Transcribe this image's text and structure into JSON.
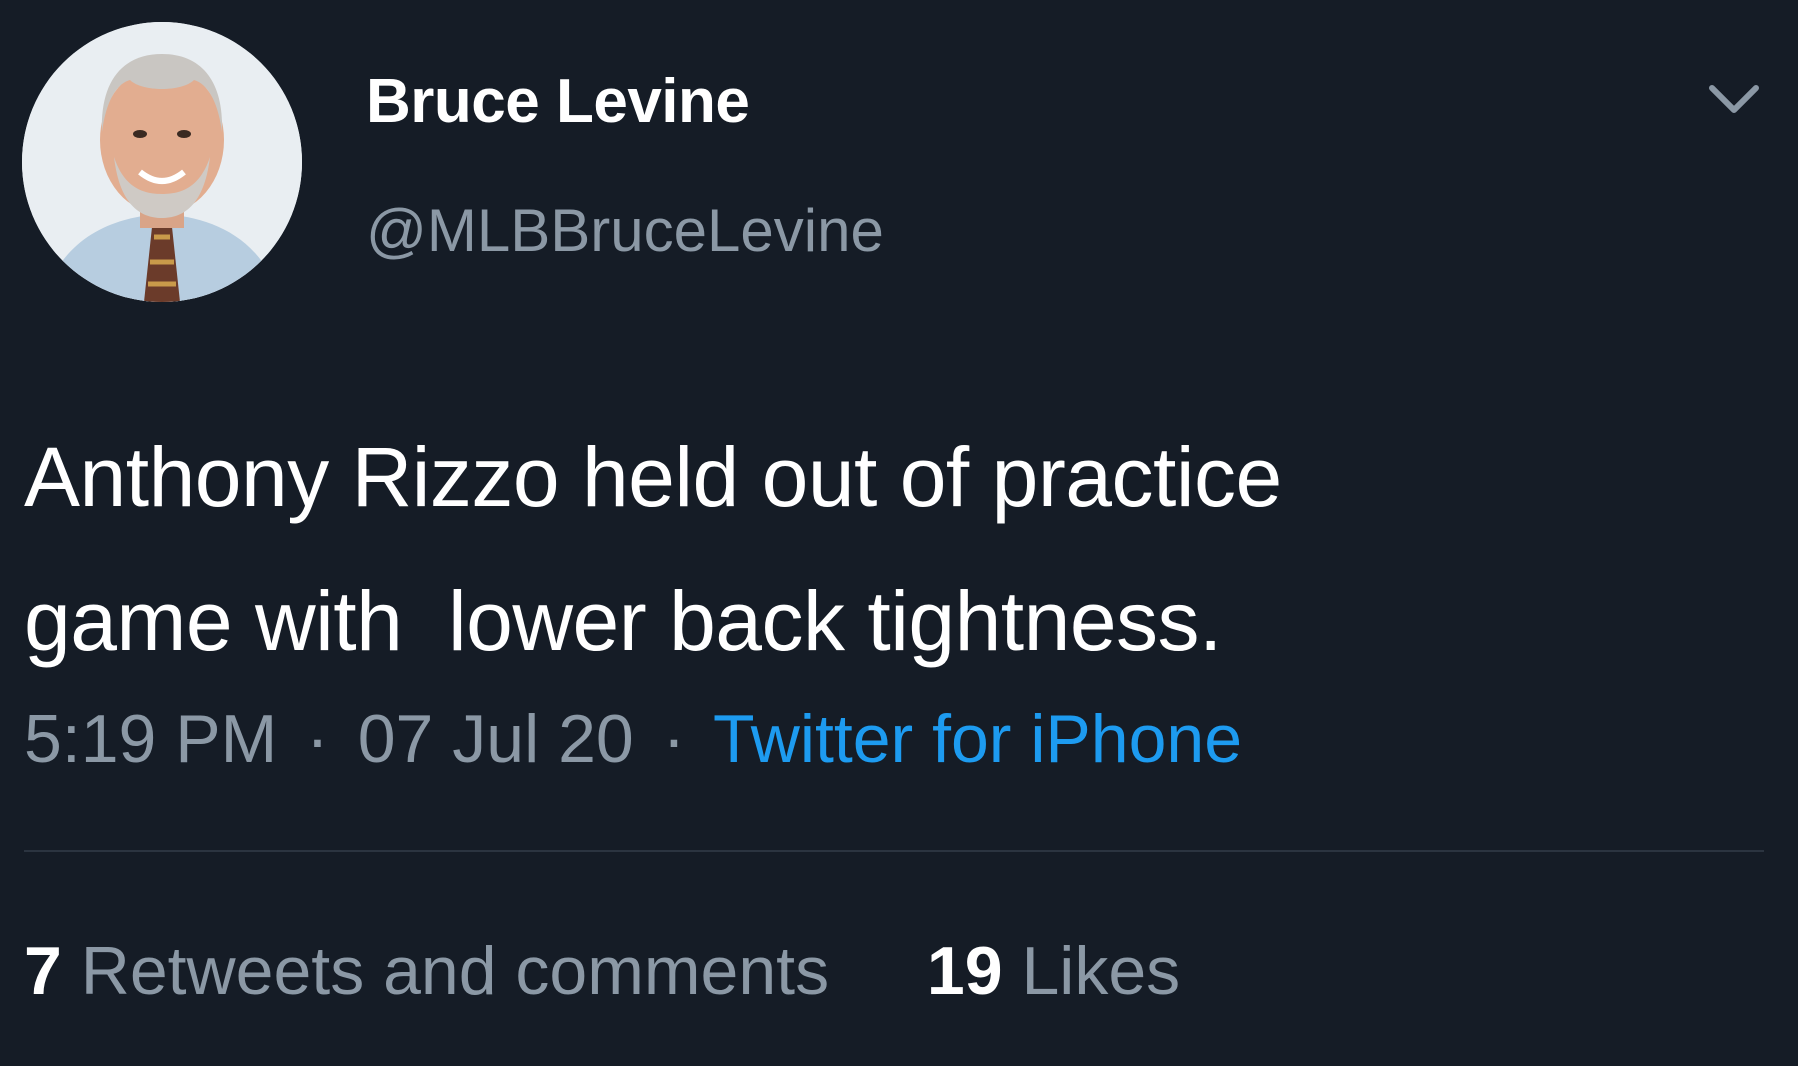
{
  "author": {
    "display_name": "Bruce Levine",
    "handle": "@MLBBruceLevine",
    "avatar_icon": "avatar-photo"
  },
  "header": {
    "menu_icon": "chevron-down-icon"
  },
  "tweet": {
    "text": "Anthony Rizzo held out of practice\ngame with  lower back tightness."
  },
  "meta": {
    "time": "5:19 PM",
    "separator": "·",
    "date": "07 Jul 20",
    "source": "Twitter for iPhone"
  },
  "stats": {
    "retweets_count": "7",
    "retweets_label": "Retweets and comments",
    "likes_count": "19",
    "likes_label": "Likes"
  },
  "colors": {
    "background": "#151c26",
    "primary_text": "#ffffff",
    "secondary_text": "#8b98a5",
    "link": "#1d9bf0",
    "divider": "#2b3440"
  }
}
